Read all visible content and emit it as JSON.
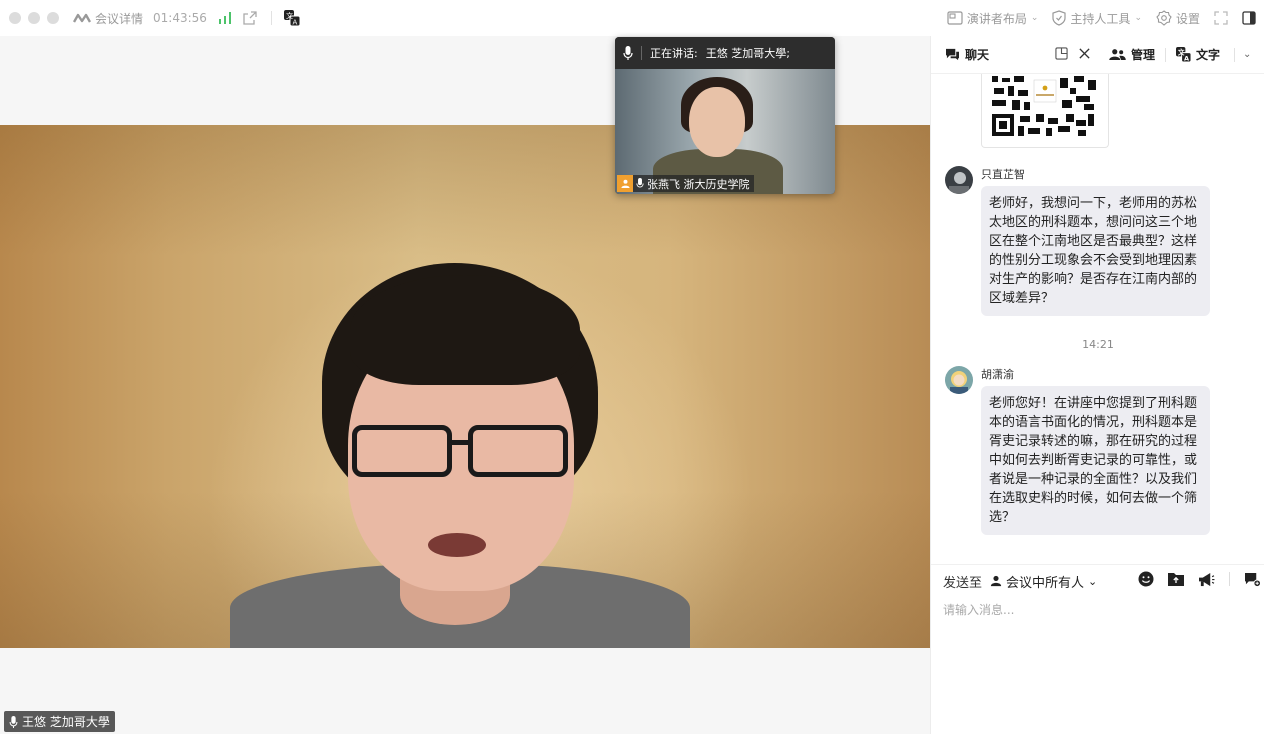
{
  "topbar": {
    "title": "会议详情",
    "timer": "01:43:56",
    "presenter_layout": "演讲者布局",
    "host_tools": "主持人工具",
    "settings": "设置"
  },
  "main_video": {
    "speaker_label": "王悠 芝加哥大學"
  },
  "thumbnail": {
    "speaking_prefix": "正在讲话:",
    "speaking_name": "王悠 芝加哥大學;",
    "participant_label": "张燕飞 浙大历史学院"
  },
  "panel": {
    "tabs": [
      {
        "label": "聊天"
      },
      {
        "label": "管理"
      },
      {
        "label": "文字"
      }
    ],
    "messages": [
      {
        "sender": "只直芷智",
        "text": "老师好，我想问一下，老师用的苏松太地区的刑科题本，想问问这三个地区在整个江南地区是否最典型？这样的性别分工现象会不会受到地理因素对生产的影响？是否存在江南内部的区域差异？"
      },
      {
        "time": "14:21"
      },
      {
        "sender": "胡潇渝",
        "text": "老师您好！在讲座中您提到了刑科题本的语言书面化的情况，刑科题本是胥吏记录转述的嘛，那在研究的过程中如何去判断胥吏记录的可靠性，或者说是一种记录的全面性？以及我们在选取史料的时候，如何去做一个筛选？"
      }
    ],
    "compose": {
      "send_to_label": "发送至",
      "recipient": "会议中所有人",
      "placeholder": "请输入消息..."
    }
  },
  "colors": {
    "signal_green": "#4cc36a",
    "tab_badge_orange": "#f0a030",
    "bubble_bg": "#ededf2"
  }
}
